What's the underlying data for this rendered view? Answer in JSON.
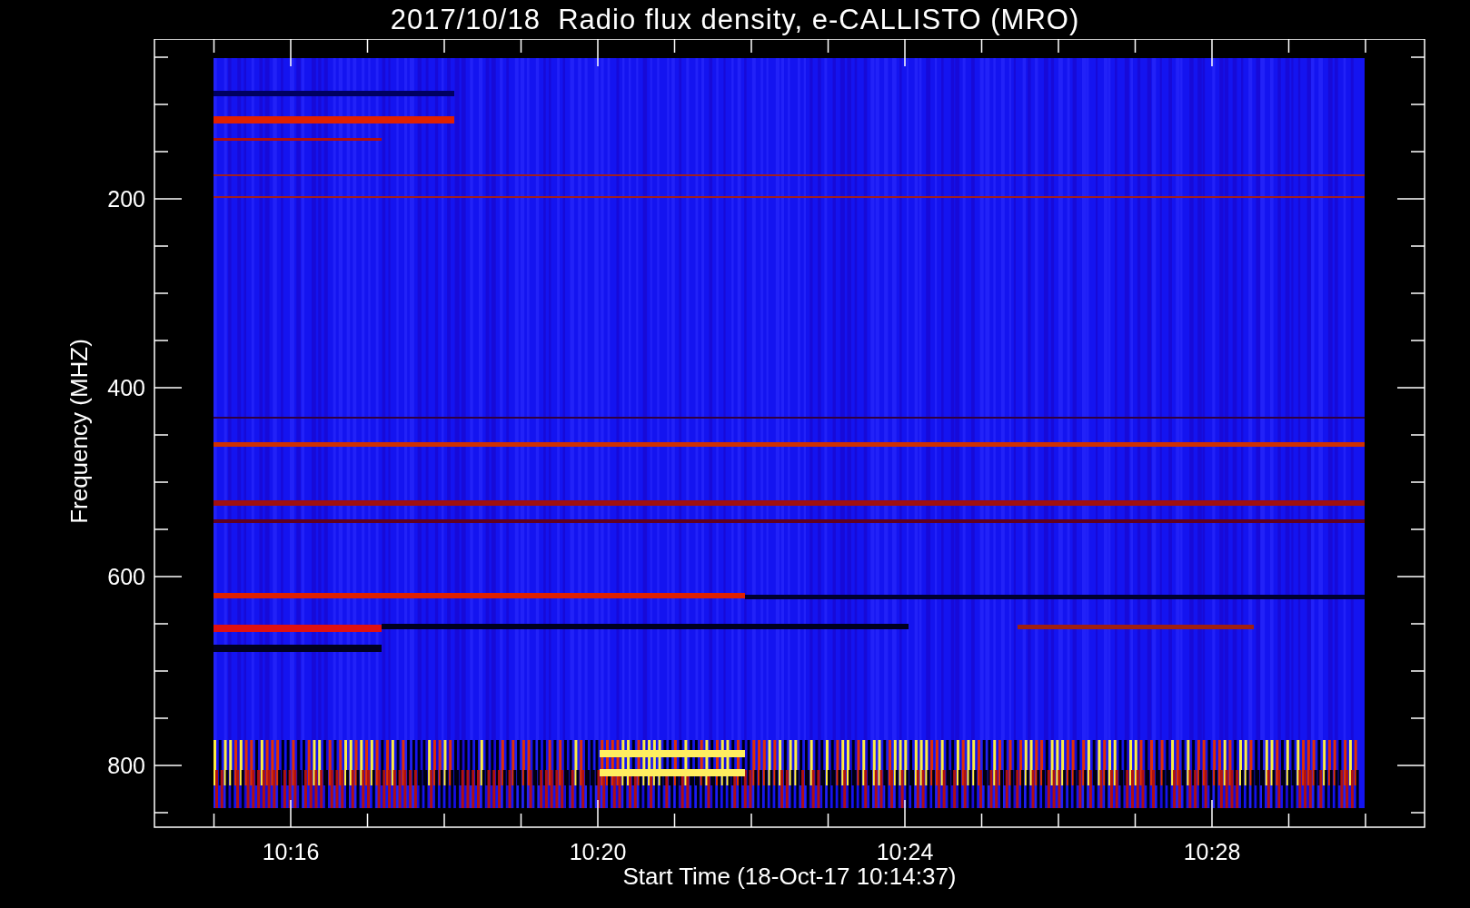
{
  "plot": {
    "title": "2017/10/18  Radio flux density, e-CALLISTO (MRO)",
    "ylabel": "Frequency (MHZ)",
    "xlabel": "Start Time (18-Oct-17 10:14:37)",
    "yticks": [
      "200",
      "400",
      "600",
      "800"
    ],
    "xticks": [
      "10:16",
      "10:20",
      "10:24",
      "10:28"
    ]
  }
}
